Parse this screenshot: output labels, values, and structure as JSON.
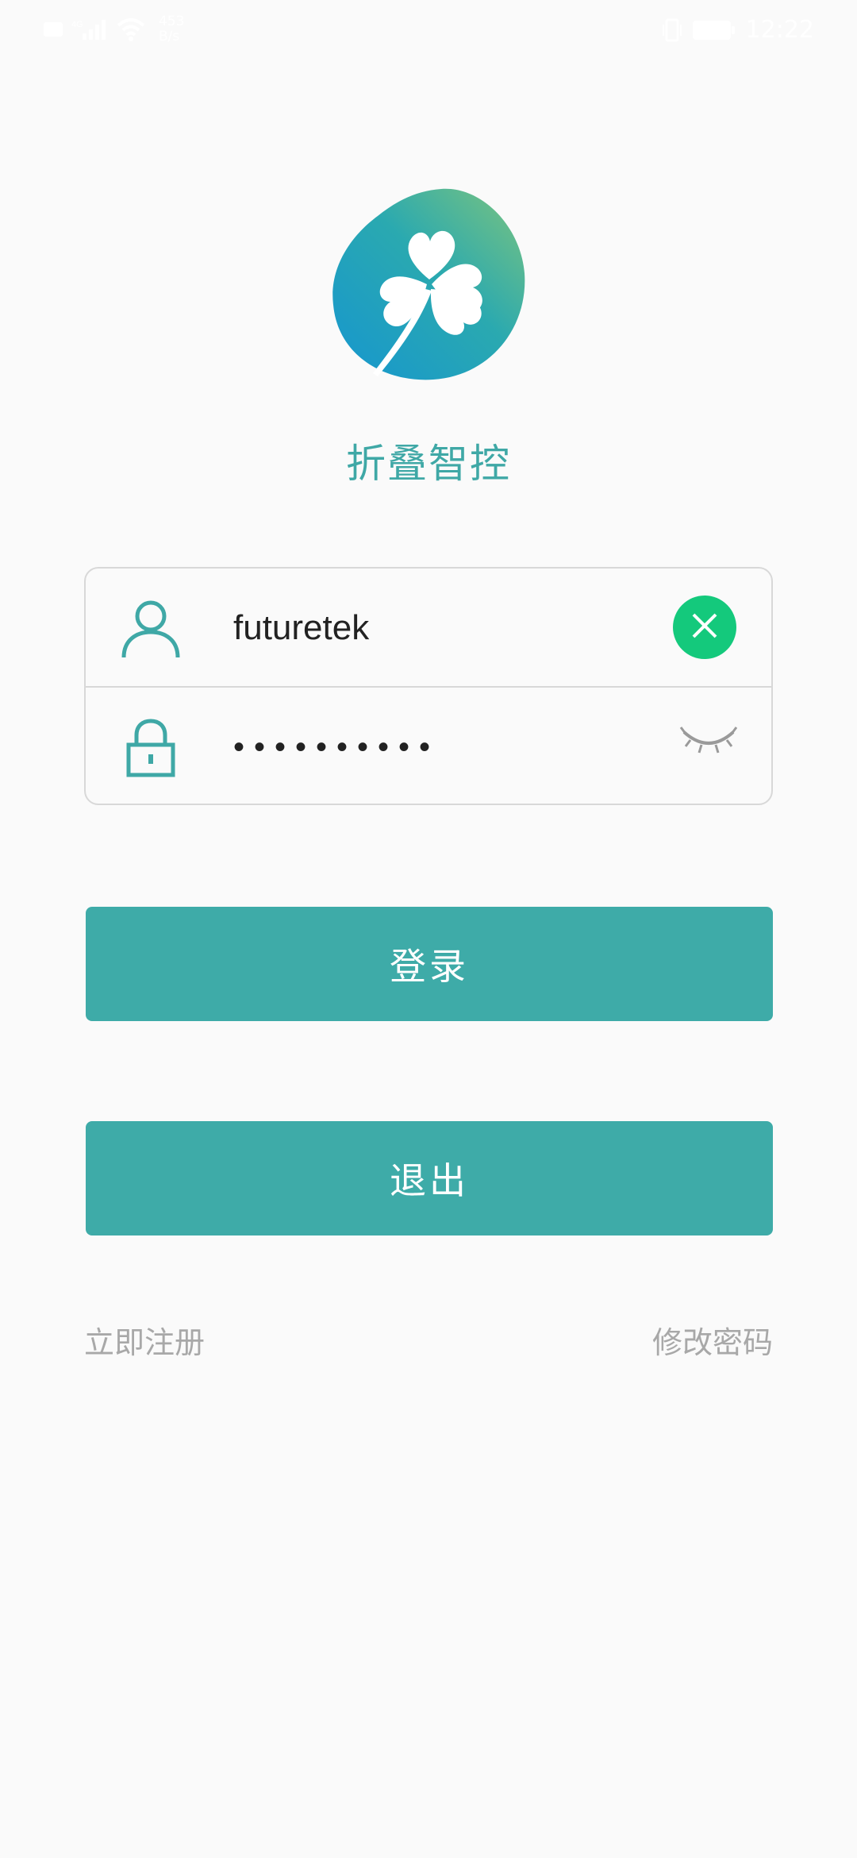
{
  "status_bar": {
    "speed_value": "453",
    "speed_unit": "B/s",
    "battery_text": "98",
    "time": "12:22"
  },
  "app": {
    "name": "折叠智控"
  },
  "form": {
    "username_value": "futuretek",
    "password_value": "1234567890"
  },
  "buttons": {
    "login_label": "登录",
    "exit_label": "退出"
  },
  "links": {
    "register": "立即注册",
    "change_password": "修改密码"
  },
  "colors": {
    "accent": "#3eaba8",
    "clear_button": "#14c97c",
    "border": "#d8d8d8",
    "link_text": "#a8a8a8"
  },
  "icons": {
    "username": "user-icon",
    "password": "lock-icon",
    "clear": "clear-icon",
    "visibility": "eye-closed-icon",
    "logo": "clover-logo"
  }
}
